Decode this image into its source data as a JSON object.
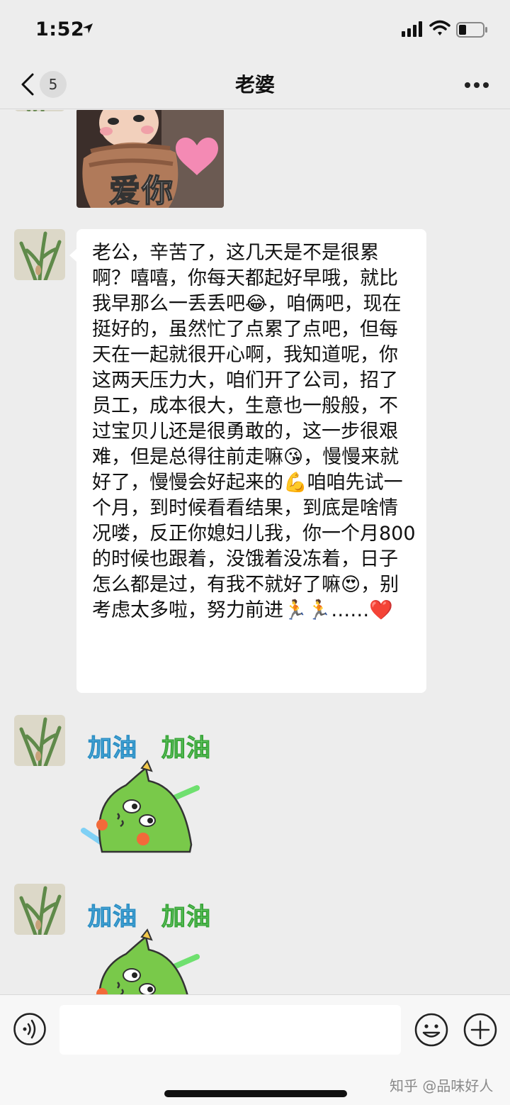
{
  "status_bar": {
    "time": "1:52",
    "icons": [
      "location-arrow-icon",
      "signal-icon",
      "wifi-icon",
      "battery-icon"
    ]
  },
  "nav": {
    "unread_count": "5",
    "title": "老婆",
    "icons": [
      "chevron-left-icon",
      "more-icon"
    ]
  },
  "messages": [
    {
      "type": "sticker",
      "caption": "爱你"
    },
    {
      "type": "text",
      "text": "老公，辛苦了，这几天是不是很累啊？嘻嘻，你每天都起好早哦，就比我早那么一丢丢吧😂，咱俩吧，现在挺好的，虽然忙了点累了点吧，但每天在一起就很开心啊，我知道呢，你这两天压力大，咱们开了公司，招了员工，成本很大，生意也一般般，不过宝贝儿还是很勇敢的，这一步很艰难，但是总得往前走嘛😘，慢慢来就好了，慢慢会好起来的💪咱咱先试一个月，到时候看看结果，到底是啥情况喽，反正你媳妇儿我，你一个月800的时候也跟着，没饿着没冻着，日子怎么都是过，有我不就好了嘛😍，别考虑太多啦，努力前进🏃🏃……❤️"
    },
    {
      "type": "sticker",
      "caption_1": "加油",
      "caption_2": "加油"
    },
    {
      "type": "sticker",
      "caption_1": "加油",
      "caption_2": "加油"
    }
  ],
  "input": {
    "placeholder": "",
    "icons": [
      "voice-icon",
      "emoji-icon",
      "plus-icon"
    ]
  },
  "watermark": "知乎 @品味好人",
  "colors": {
    "background": "#ededed",
    "bubble": "#ffffff",
    "jiayou_blue": "#6ec6f0",
    "jiayou_green": "#8be08b",
    "dino_green": "#79c94a"
  }
}
